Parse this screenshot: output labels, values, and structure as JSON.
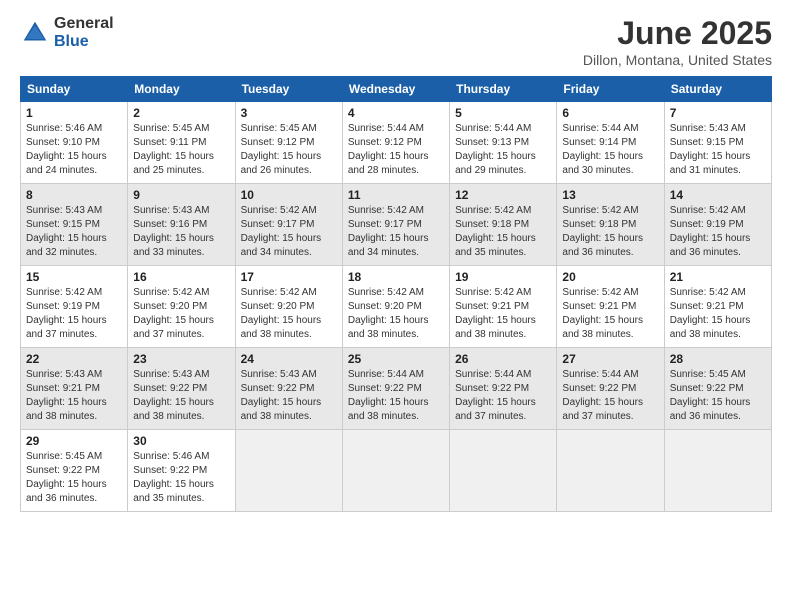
{
  "header": {
    "logo_general": "General",
    "logo_blue": "Blue",
    "month_title": "June 2025",
    "location": "Dillon, Montana, United States"
  },
  "calendar": {
    "days_of_week": [
      "Sunday",
      "Monday",
      "Tuesday",
      "Wednesday",
      "Thursday",
      "Friday",
      "Saturday"
    ],
    "weeks": [
      [
        {
          "day": "1",
          "sunrise": "Sunrise: 5:46 AM",
          "sunset": "Sunset: 9:10 PM",
          "daylight": "Daylight: 15 hours and 24 minutes."
        },
        {
          "day": "2",
          "sunrise": "Sunrise: 5:45 AM",
          "sunset": "Sunset: 9:11 PM",
          "daylight": "Daylight: 15 hours and 25 minutes."
        },
        {
          "day": "3",
          "sunrise": "Sunrise: 5:45 AM",
          "sunset": "Sunset: 9:12 PM",
          "daylight": "Daylight: 15 hours and 26 minutes."
        },
        {
          "day": "4",
          "sunrise": "Sunrise: 5:44 AM",
          "sunset": "Sunset: 9:12 PM",
          "daylight": "Daylight: 15 hours and 28 minutes."
        },
        {
          "day": "5",
          "sunrise": "Sunrise: 5:44 AM",
          "sunset": "Sunset: 9:13 PM",
          "daylight": "Daylight: 15 hours and 29 minutes."
        },
        {
          "day": "6",
          "sunrise": "Sunrise: 5:44 AM",
          "sunset": "Sunset: 9:14 PM",
          "daylight": "Daylight: 15 hours and 30 minutes."
        },
        {
          "day": "7",
          "sunrise": "Sunrise: 5:43 AM",
          "sunset": "Sunset: 9:15 PM",
          "daylight": "Daylight: 15 hours and 31 minutes."
        }
      ],
      [
        {
          "day": "8",
          "sunrise": "Sunrise: 5:43 AM",
          "sunset": "Sunset: 9:15 PM",
          "daylight": "Daylight: 15 hours and 32 minutes."
        },
        {
          "day": "9",
          "sunrise": "Sunrise: 5:43 AM",
          "sunset": "Sunset: 9:16 PM",
          "daylight": "Daylight: 15 hours and 33 minutes."
        },
        {
          "day": "10",
          "sunrise": "Sunrise: 5:42 AM",
          "sunset": "Sunset: 9:17 PM",
          "daylight": "Daylight: 15 hours and 34 minutes."
        },
        {
          "day": "11",
          "sunrise": "Sunrise: 5:42 AM",
          "sunset": "Sunset: 9:17 PM",
          "daylight": "Daylight: 15 hours and 34 minutes."
        },
        {
          "day": "12",
          "sunrise": "Sunrise: 5:42 AM",
          "sunset": "Sunset: 9:18 PM",
          "daylight": "Daylight: 15 hours and 35 minutes."
        },
        {
          "day": "13",
          "sunrise": "Sunrise: 5:42 AM",
          "sunset": "Sunset: 9:18 PM",
          "daylight": "Daylight: 15 hours and 36 minutes."
        },
        {
          "day": "14",
          "sunrise": "Sunrise: 5:42 AM",
          "sunset": "Sunset: 9:19 PM",
          "daylight": "Daylight: 15 hours and 36 minutes."
        }
      ],
      [
        {
          "day": "15",
          "sunrise": "Sunrise: 5:42 AM",
          "sunset": "Sunset: 9:19 PM",
          "daylight": "Daylight: 15 hours and 37 minutes."
        },
        {
          "day": "16",
          "sunrise": "Sunrise: 5:42 AM",
          "sunset": "Sunset: 9:20 PM",
          "daylight": "Daylight: 15 hours and 37 minutes."
        },
        {
          "day": "17",
          "sunrise": "Sunrise: 5:42 AM",
          "sunset": "Sunset: 9:20 PM",
          "daylight": "Daylight: 15 hours and 38 minutes."
        },
        {
          "day": "18",
          "sunrise": "Sunrise: 5:42 AM",
          "sunset": "Sunset: 9:20 PM",
          "daylight": "Daylight: 15 hours and 38 minutes."
        },
        {
          "day": "19",
          "sunrise": "Sunrise: 5:42 AM",
          "sunset": "Sunset: 9:21 PM",
          "daylight": "Daylight: 15 hours and 38 minutes."
        },
        {
          "day": "20",
          "sunrise": "Sunrise: 5:42 AM",
          "sunset": "Sunset: 9:21 PM",
          "daylight": "Daylight: 15 hours and 38 minutes."
        },
        {
          "day": "21",
          "sunrise": "Sunrise: 5:42 AM",
          "sunset": "Sunset: 9:21 PM",
          "daylight": "Daylight: 15 hours and 38 minutes."
        }
      ],
      [
        {
          "day": "22",
          "sunrise": "Sunrise: 5:43 AM",
          "sunset": "Sunset: 9:21 PM",
          "daylight": "Daylight: 15 hours and 38 minutes."
        },
        {
          "day": "23",
          "sunrise": "Sunrise: 5:43 AM",
          "sunset": "Sunset: 9:22 PM",
          "daylight": "Daylight: 15 hours and 38 minutes."
        },
        {
          "day": "24",
          "sunrise": "Sunrise: 5:43 AM",
          "sunset": "Sunset: 9:22 PM",
          "daylight": "Daylight: 15 hours and 38 minutes."
        },
        {
          "day": "25",
          "sunrise": "Sunrise: 5:44 AM",
          "sunset": "Sunset: 9:22 PM",
          "daylight": "Daylight: 15 hours and 38 minutes."
        },
        {
          "day": "26",
          "sunrise": "Sunrise: 5:44 AM",
          "sunset": "Sunset: 9:22 PM",
          "daylight": "Daylight: 15 hours and 37 minutes."
        },
        {
          "day": "27",
          "sunrise": "Sunrise: 5:44 AM",
          "sunset": "Sunset: 9:22 PM",
          "daylight": "Daylight: 15 hours and 37 minutes."
        },
        {
          "day": "28",
          "sunrise": "Sunrise: 5:45 AM",
          "sunset": "Sunset: 9:22 PM",
          "daylight": "Daylight: 15 hours and 36 minutes."
        }
      ],
      [
        {
          "day": "29",
          "sunrise": "Sunrise: 5:45 AM",
          "sunset": "Sunset: 9:22 PM",
          "daylight": "Daylight: 15 hours and 36 minutes."
        },
        {
          "day": "30",
          "sunrise": "Sunrise: 5:46 AM",
          "sunset": "Sunset: 9:22 PM",
          "daylight": "Daylight: 15 hours and 35 minutes."
        },
        {
          "day": "",
          "sunrise": "",
          "sunset": "",
          "daylight": ""
        },
        {
          "day": "",
          "sunrise": "",
          "sunset": "",
          "daylight": ""
        },
        {
          "day": "",
          "sunrise": "",
          "sunset": "",
          "daylight": ""
        },
        {
          "day": "",
          "sunrise": "",
          "sunset": "",
          "daylight": ""
        },
        {
          "day": "",
          "sunrise": "",
          "sunset": "",
          "daylight": ""
        }
      ]
    ]
  }
}
